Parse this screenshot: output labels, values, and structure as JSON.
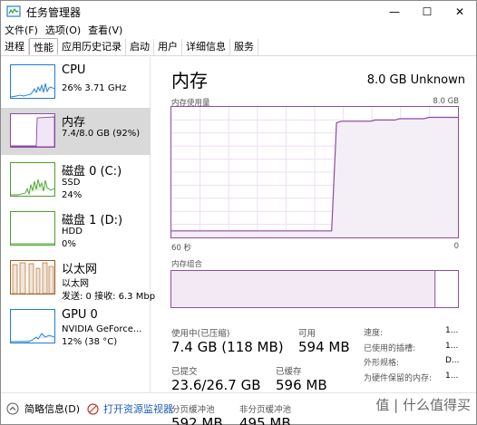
{
  "window": {
    "title": "任务管理器",
    "controls": {
      "minimize": "—",
      "maximize": "☐",
      "close": "✕"
    }
  },
  "menu": [
    "文件(F)",
    "选项(O)",
    "查看(V)"
  ],
  "tabs": [
    "进程",
    "性能",
    "应用历史记录",
    "启动",
    "用户",
    "详细信息",
    "服务"
  ],
  "active_tab": "性能",
  "sidebar": {
    "items": [
      {
        "title": "CPU",
        "sub1": "26%  3.71 GHz",
        "sub2": "",
        "color": "#1e7bd1",
        "bg": ""
      },
      {
        "title": "内存",
        "sub1": "7.4/8.0 GB (92%)",
        "sub2": "",
        "color": "#8b4ba3",
        "bg": "#d9d9d9"
      },
      {
        "title": "磁盘 0 (C:)",
        "sub1": "SSD",
        "sub2": "24%",
        "color": "#4aa02c",
        "bg": ""
      },
      {
        "title": "磁盘 1 (D:)",
        "sub1": "HDD",
        "sub2": "0%",
        "color": "#4aa02c",
        "bg": ""
      },
      {
        "title": "以太网",
        "sub1": "以太网",
        "sub2": "发送: 0  接收: 6.3 Mbp",
        "color": "#a15a1b",
        "bg": ""
      },
      {
        "title": "GPU 0",
        "sub1": "NVIDIA GeForce...",
        "sub2": "12% (38 °C)",
        "color": "#1e7bd1",
        "bg": ""
      }
    ]
  },
  "main": {
    "title": "内存",
    "capacity": "8.0 GB Unknown",
    "usage_label": "内存使用量",
    "usage_max": "8.0 GB",
    "axis_left": "60 秒",
    "axis_right": "0",
    "composition_label": "内存组合",
    "usage_fraction_history": [
      0.05,
      0.05,
      0.05,
      0.05,
      0.05,
      0.05,
      0.05,
      0.05,
      0.05,
      0.05,
      0.05,
      0.05,
      0.05,
      0.05,
      0.05,
      0.05,
      0.05,
      0.05,
      0.05,
      0.05,
      0.05,
      0.05,
      0.05,
      0.05,
      0.05,
      0.05,
      0.05,
      0.05,
      0.05,
      0.05,
      0.05,
      0.05,
      0.05,
      0.05,
      0.88,
      0.89,
      0.89,
      0.89,
      0.89,
      0.89,
      0.89,
      0.89,
      0.9,
      0.9,
      0.9,
      0.9,
      0.9,
      0.91,
      0.91,
      0.91,
      0.91,
      0.91,
      0.91,
      0.92,
      0.92,
      0.92,
      0.92,
      0.92,
      0.92,
      0.92
    ],
    "in_use_fraction": 0.92,
    "stats": {
      "in_use_label": "使用中(已压缩)",
      "in_use_value": "7.4 GB (118 MB)",
      "available_label": "可用",
      "available_value": "594 MB",
      "committed_label": "已提交",
      "committed_value": "23.6/26.7 GB",
      "cached_label": "已缓存",
      "cached_value": "596 MB",
      "paged_label": "分页缓冲池",
      "paged_value": "592 MB",
      "nonpaged_label": "非分页缓冲池",
      "nonpaged_value": "495 MB"
    },
    "details": [
      {
        "k": "速度:",
        "v": "1..."
      },
      {
        "k": "已使用的插槽:",
        "v": "1..."
      },
      {
        "k": "外形规格:",
        "v": "D..."
      },
      {
        "k": "为硬件保留的内存:",
        "v": "1..."
      }
    ]
  },
  "footer": {
    "brief": "简略信息(D)",
    "monitor_link": "打开资源监视器",
    "watermark": "值 | 什么值得买"
  }
}
